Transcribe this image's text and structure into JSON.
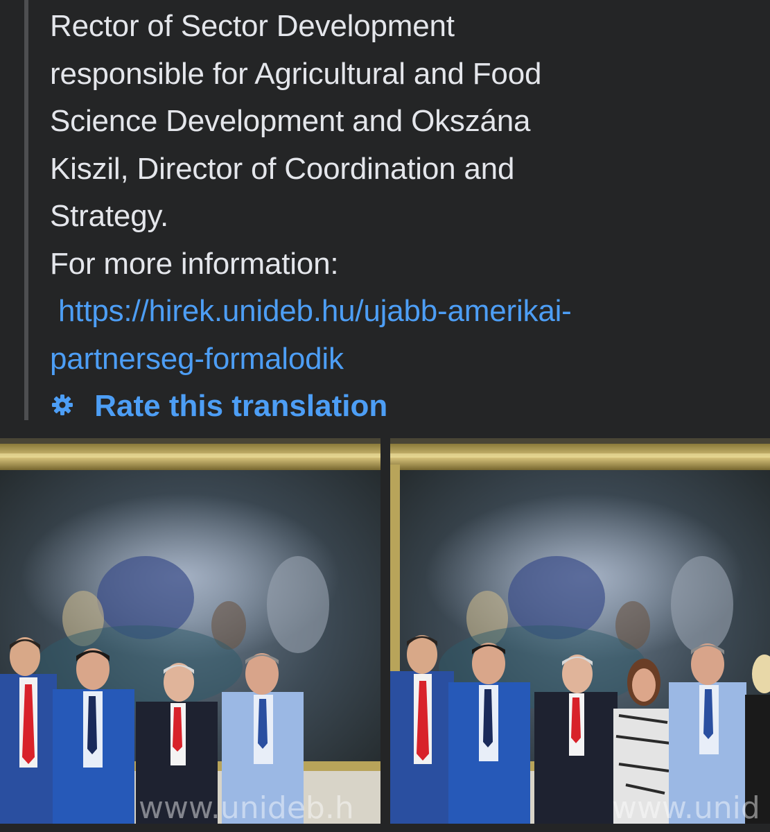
{
  "post": {
    "lines": [
      "Rector of Sector Development",
      "responsible for Agricultural and Food",
      "Science Development and Okszána",
      "Kiszil, Director of Coordination and",
      "Strategy.",
      "For more information:"
    ],
    "link_line_1": " https://hirek.unideb.hu/ujabb-amerikai-",
    "link_line_2": "partnerseg-formalodik",
    "rate_label": "Rate this translation",
    "rate_icon": "gear-icon"
  },
  "photos": [
    {
      "watermark": "www.unideb.h"
    },
    {
      "watermark": "www.unid"
    }
  ],
  "colors": {
    "background": "#242526",
    "text": "#e4e6eb",
    "link": "#4d9ef5",
    "quote_bar": "#4e4f51"
  }
}
